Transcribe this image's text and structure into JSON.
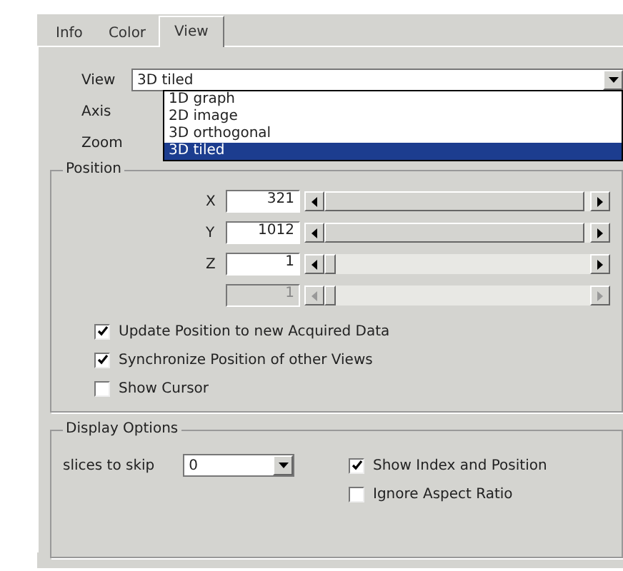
{
  "tabs": [
    {
      "label": "Info",
      "selected": false
    },
    {
      "label": "Color",
      "selected": false
    },
    {
      "label": "View",
      "selected": true
    }
  ],
  "view": {
    "label": "View",
    "value": "3D tiled",
    "options": [
      {
        "label": "1D graph",
        "selected": false
      },
      {
        "label": "2D image",
        "selected": false
      },
      {
        "label": "3D orthogonal",
        "selected": false
      },
      {
        "label": "3D tiled",
        "selected": true
      }
    ]
  },
  "axis": {
    "label": "Axis"
  },
  "zoom": {
    "label": "Zoom"
  },
  "position": {
    "title": "Position",
    "rows": [
      {
        "label": "X",
        "value": "321",
        "disabled": false
      },
      {
        "label": "Y",
        "value": "1012",
        "disabled": false
      },
      {
        "label": "Z",
        "value": "1",
        "disabled": false
      },
      {
        "value": "1",
        "disabled": true
      }
    ],
    "options": [
      {
        "label": "Update Position to new Acquired Data",
        "checked": true
      },
      {
        "label": "Synchronize Position of other Views",
        "checked": true
      },
      {
        "label": "Show Cursor",
        "checked": false
      }
    ]
  },
  "display_options": {
    "title": "Display Options",
    "slices_label": "slices to skip",
    "slices_value": "0",
    "options": [
      {
        "label": "Show Index and Position",
        "checked": true
      },
      {
        "label": "Ignore Aspect Ratio",
        "checked": false
      }
    ]
  }
}
